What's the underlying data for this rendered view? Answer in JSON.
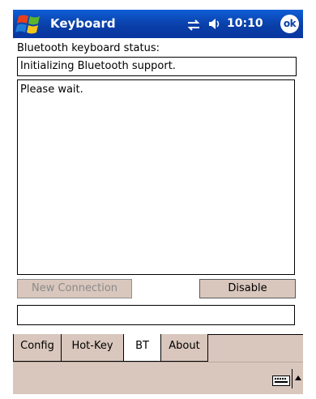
{
  "titlebar": {
    "title": "Keyboard",
    "clock": "10:10",
    "ok_label": "ok",
    "icons": [
      "windows-start-icon",
      "connectivity-icon",
      "volume-icon"
    ]
  },
  "main": {
    "status_label": "Bluetooth keyboard status:",
    "status_value": "Initializing Bluetooth support.",
    "log_text": "Please wait.",
    "new_connection_label": "New Connection",
    "disable_label": "Disable",
    "message_value": ""
  },
  "tabs": [
    {
      "label": "Config"
    },
    {
      "label": "Hot-Key"
    },
    {
      "label": "BT"
    },
    {
      "label": "About"
    }
  ],
  "active_tab": "BT",
  "menubar": {
    "icons": [
      "keyboard-icon",
      "sip-up-arrow-icon"
    ]
  },
  "colors": {
    "titlebar": "#0a3fa8",
    "chrome": "#d9c7bd",
    "disabled_text": "#8a8a8a"
  }
}
